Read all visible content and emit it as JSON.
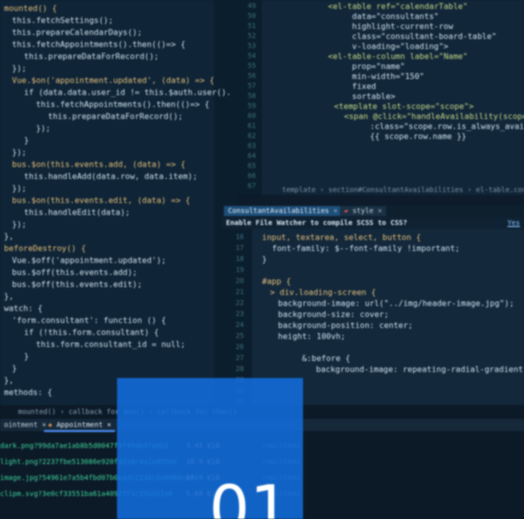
{
  "colors": {
    "keyword": "#e5c07b",
    "default": "#cfe3f0",
    "string": "#98c379",
    "property": "#e5c07b",
    "number": "#61afef",
    "tag": "#c6d88a",
    "accent": "#1e7bff"
  },
  "left_code": [
    [
      [
        "mounted() {",
        "keyword"
      ]
    ],
    [
      [
        "this.fetchSettings();",
        "default"
      ]
    ],
    [
      [
        "this.prepareCalendarDays();",
        "default"
      ]
    ],
    [
      [
        "this.fetchAppointments().then(()=> {",
        "default"
      ]
    ],
    [
      [
        "this.prepareDataForRecord();",
        "default"
      ]
    ],
    [
      [
        "});",
        "default"
      ]
    ],
    [
      [
        "Vue.$on('appointment.updated', (data) => {",
        "keyword"
      ]
    ],
    [
      [
        "if (data.data.user_id != this.$auth.user().",
        "default"
      ]
    ],
    [
      [
        "this.fetchAppointments().then(()=> {",
        "default"
      ]
    ],
    [
      [
        "this.prepareDataForRecord();",
        "default"
      ]
    ],
    [
      [
        "});",
        "default"
      ]
    ],
    [
      [
        "}",
        "default"
      ]
    ],
    [
      [
        "});",
        "default"
      ]
    ],
    [
      [
        "bus.$on(this.events.add, (data) => {",
        "keyword"
      ]
    ],
    [
      [
        "this.handleAdd(data.row, data.item);",
        "default"
      ]
    ],
    [
      [
        "});",
        "default"
      ]
    ],
    [
      [
        "bus.$on(this.events.edit, (data) => {",
        "keyword"
      ]
    ],
    [
      [
        "this.handleEdit(data);",
        "default"
      ]
    ],
    [
      [
        "});",
        "default"
      ]
    ],
    [
      [
        "},",
        "default"
      ]
    ],
    [
      [
        "beforeDestroy() {",
        "keyword"
      ]
    ],
    [
      [
        "Vue.$off('appointment.updated');",
        "default"
      ]
    ],
    [
      [
        "bus.$off(this.events.add);",
        "default"
      ]
    ],
    [
      [
        "bus.$off(this.events.edit);",
        "default"
      ]
    ],
    [
      [
        "},",
        "default"
      ]
    ],
    [
      [
        "watch: {",
        "default"
      ]
    ],
    [
      [
        "'form.consultant': function () {",
        "default"
      ]
    ],
    [
      [
        "if (!this.form.consultant) {",
        "default"
      ]
    ],
    [
      [
        "this.form.consultant_id = null;",
        "default"
      ]
    ],
    [
      [
        "}",
        "default"
      ]
    ],
    [
      [
        "}",
        "default"
      ]
    ],
    [
      [
        "},",
        "default"
      ]
    ],
    [
      [
        "methods: {",
        "default"
      ]
    ]
  ],
  "right_top_line_numbers": [
    "49",
    "50",
    "51",
    "52",
    "53",
    "54",
    "55",
    "56",
    "57",
    "58",
    "59",
    "60",
    "61",
    "62",
    "63",
    "64",
    "65",
    "66",
    "67"
  ],
  "right_top_code": [
    [
      [
        "<el-table ref=\"calendarTable\"",
        "tag"
      ]
    ],
    [
      [
        "data=\"consultants\"",
        "default"
      ]
    ],
    [
      [
        "highlight-current-row",
        "default"
      ]
    ],
    [
      [
        "class=\"consultant-board-table\"",
        "default"
      ]
    ],
    [
      [
        "v-loading=\"loading\">",
        "default"
      ]
    ],
    [
      [
        "<el-table-column label=\"Name\"",
        "tag"
      ]
    ],
    [
      [
        "prop=\"name\"",
        "default"
      ]
    ],
    [
      [
        "min-width=\"150\"",
        "default"
      ]
    ],
    [
      [
        "fixed",
        "default"
      ]
    ],
    [
      [
        "sortable>",
        "default"
      ]
    ],
    [
      [
        "<template slot-scope=\"scope\">",
        "tag"
      ]
    ],
    [
      [
        "<span @click=\"handleAvailability(scope.ro",
        "tag"
      ]
    ],
    [
      [
        ":class=\"scope.row.is_always_availabl",
        "default"
      ]
    ],
    [
      [
        "{{ scope.row.name }}",
        "default"
      ]
    ],
    [
      [
        "",
        "default"
      ]
    ],
    [
      [
        "",
        "default"
      ]
    ],
    [
      [
        "",
        "default"
      ]
    ],
    [
      [
        "",
        "default"
      ]
    ],
    [
      [
        "",
        "default"
      ]
    ]
  ],
  "right_top_breadcrumb": "template › section#ConsultantAvailabilities › el-table.consultant-board-t",
  "right_bottom_tabs": [
    "ConsultantAvailabilities",
    "style"
  ],
  "hint_text": "Enable File Watcher to compile SCSS to CSS?",
  "hint_action": "Yes",
  "right_bottom_line_numbers": [
    "16",
    "17",
    "18",
    "19",
    "20",
    "21",
    "22",
    "23",
    "24",
    "25",
    "26",
    "27",
    "28",
    "29",
    "30",
    "31",
    "32",
    "33",
    "34"
  ],
  "right_bottom_code": [
    [
      [
        "input, textarea, select, button {",
        "keyword"
      ]
    ],
    [
      [
        "font-family: $--font-family !important;",
        "default"
      ]
    ],
    [
      [
        "}",
        "default"
      ]
    ],
    [
      [
        "",
        "default"
      ]
    ],
    [
      [
        "#app {",
        "keyword"
      ]
    ],
    [
      [
        "> div.loading-screen {",
        "keyword"
      ]
    ],
    [
      [
        "background-image: url(\"../img/header-image.jpg\");",
        "default"
      ]
    ],
    [
      [
        "background-size: cover;",
        "default"
      ]
    ],
    [
      [
        "background-position: center;",
        "default"
      ]
    ],
    [
      [
        "height: 100vh;",
        "default"
      ]
    ],
    [
      [
        "",
        "default"
      ]
    ],
    [
      [
        "&:before {",
        "default"
      ]
    ],
    [
      [
        "background-image: repeating-radial-gradient(circle at c",
        "default"
      ]
    ],
    [
      [
        "",
        "default"
      ]
    ],
    [
      [
        "",
        "default"
      ]
    ],
    [
      [
        "",
        "default"
      ]
    ],
    [
      [
        "",
        "default"
      ]
    ],
    [
      [
        "",
        "default"
      ]
    ],
    [
      [
        "",
        "default"
      ]
    ]
  ],
  "bottom_breadcrumb": "mounted()  ›  callback for $on()  ›  callback for then()",
  "bottom_tabs": [
    "ointment",
    "Appointment"
  ],
  "network_rows": [
    {
      "file": "dark.png?99da7ae1ab8b5d0047f9f454b97a5b1",
      "size": "3.45 KiB",
      "status": "(omitted)"
    },
    {
      "file": "light.png?2237fbe513086e920fdd16c4a1e9556e",
      "size": "10.9 KiB",
      "status": "(omitted)"
    },
    {
      "file": "image.jpg?54961e7a5b4fbd07b0ea3c2238c2e6088ca79",
      "size": "84.9 KiB",
      "status": "(omitted)"
    },
    {
      "file": "clipm.svg?3e0cf33551ba61a40927f3c15b921e6",
      "size": "5.88 KiB",
      "status": "(omitted)"
    }
  ],
  "overlay_number": "01"
}
